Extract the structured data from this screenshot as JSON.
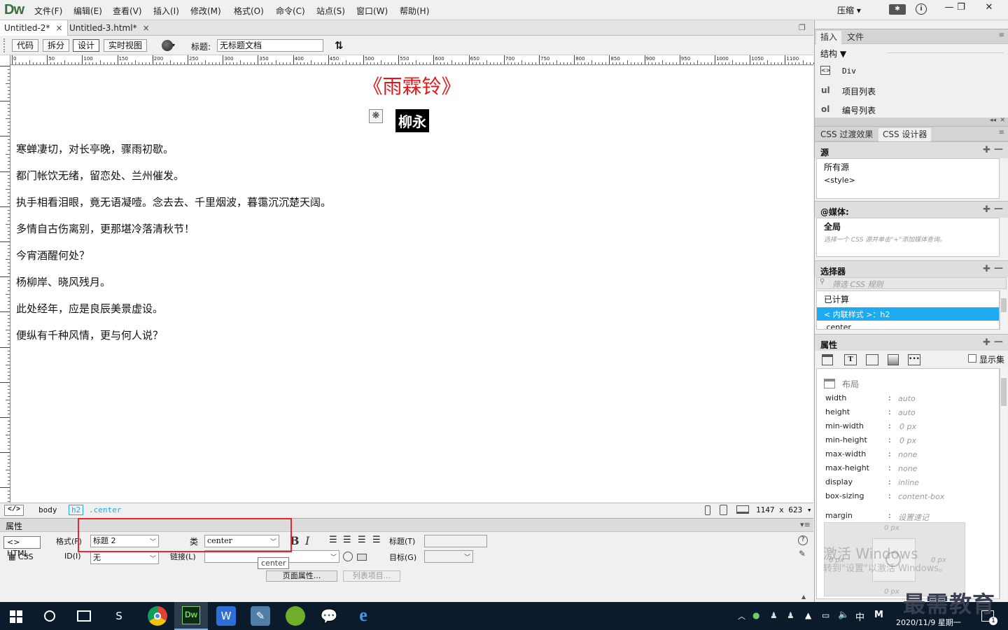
{
  "app": {
    "logo": "Dw"
  },
  "menu": [
    "文件(F)",
    "编辑(E)",
    "查看(V)",
    "插入(I)",
    "修改(M)",
    "格式(O)",
    "命令(C)",
    "站点(S)",
    "窗口(W)",
    "帮助(H)"
  ],
  "workspace": {
    "label": "压缩"
  },
  "tabs": [
    {
      "label": "Untitled-2*",
      "close": "×"
    },
    {
      "label": "Untitled-3.html*",
      "close": "×"
    }
  ],
  "doc_toolbar": {
    "views": [
      "代码",
      "拆分",
      "设计",
      "实时视图"
    ],
    "title_label": "标题:",
    "title_value": "无标题文档"
  },
  "ruler_marks": [
    "0",
    "50",
    "100",
    "150",
    "200",
    "250",
    "300",
    "350",
    "400",
    "450",
    "500",
    "550",
    "600",
    "650",
    "700",
    "750",
    "800",
    "850",
    "900",
    "950",
    "1000",
    "1050",
    "1100"
  ],
  "document": {
    "title": "《雨霖铃》",
    "author": "柳永",
    "lines": [
      "寒蝉凄切，对长亭晚，骤雨初歇。",
      "都门帐饮无绪，留恋处、兰州催发。",
      "执手相看泪眼，竟无语凝噎。念去去、千里烟波，暮霭沉沉楚天阔。",
      "多情自古伤离别，更那堪冷落清秋节！",
      "今宵酒醒何处？",
      "杨柳岸、晓风残月。",
      "此处经年，应是良辰美景虚设。",
      "便纵有千种风情，更与何人说？"
    ]
  },
  "tag_selector": {
    "body": "body",
    "h2": "h2",
    "class": ".center",
    "window_size": "1147 x 623"
  },
  "properties": {
    "header": "属性",
    "html_btn": "HTML",
    "css_btn": "CSS",
    "format_label": "格式(F)",
    "format_value": "标题 2",
    "id_label": "ID(I)",
    "id_value": "无",
    "class_label": "类",
    "class_value": "center",
    "tooltip": "center",
    "link_label": "链接(L)",
    "heading_label": "标题(T)",
    "target_label": "目标(G)",
    "page_props_btn": "页面属性...",
    "list_item_btn": "列表项目..."
  },
  "insert_panel": {
    "tabs": [
      "插入",
      "文件"
    ],
    "category": "结构",
    "items": [
      {
        "tag": "div",
        "label": "Div"
      },
      {
        "tag": "ul",
        "label": "项目列表"
      },
      {
        "tag": "ol",
        "label": "编号列表"
      }
    ]
  },
  "css_panel": {
    "tabs": [
      "CSS 过渡效果",
      "CSS 设计器"
    ],
    "sources_header": "源",
    "sources": [
      "所有源",
      "<style>"
    ],
    "media_header": "@媒体:",
    "media_global": "全局",
    "media_hint": "选择一个 CSS 源并单击\"+\"添加媒体查询。",
    "selectors_header": "选择器",
    "selector_filter_placeholder": "筛选 CSS 规则",
    "selectors": [
      "已计算",
      "< 内联样式 >：h2",
      ".center"
    ],
    "props_header": "属性",
    "show_set_label": "显示集",
    "layout_label": "布局",
    "props": [
      {
        "name": "width",
        "value": "auto"
      },
      {
        "name": "height",
        "value": "auto"
      },
      {
        "name": "min-width",
        "value": "0 px"
      },
      {
        "name": "min-height",
        "value": "0 px"
      },
      {
        "name": "max-width",
        "value": "none"
      },
      {
        "name": "max-height",
        "value": "none"
      },
      {
        "name": "display",
        "value": "inline"
      },
      {
        "name": "box-sizing",
        "value": "content-box"
      },
      {
        "name": "margin",
        "value": "设置速记"
      }
    ],
    "margin_box": {
      "top": "0 px",
      "left": "0 px",
      "right": "0 px",
      "bottom": "0 px"
    }
  },
  "watermark": {
    "line1": "激活 Windows",
    "line2": "转到\"设置\"以激活 Windows。"
  },
  "brand_overlay": "最需教育",
  "taskbar": {
    "ime": "中",
    "ime2": "M",
    "date": "2020/11/9 星期一",
    "notification_count": "1"
  },
  "colors": {
    "title_red": "#e01818",
    "selection_blue": "#1eaaf1",
    "highlight_red": "#e8282b",
    "taskbar_bg": "#0c1b2c"
  }
}
